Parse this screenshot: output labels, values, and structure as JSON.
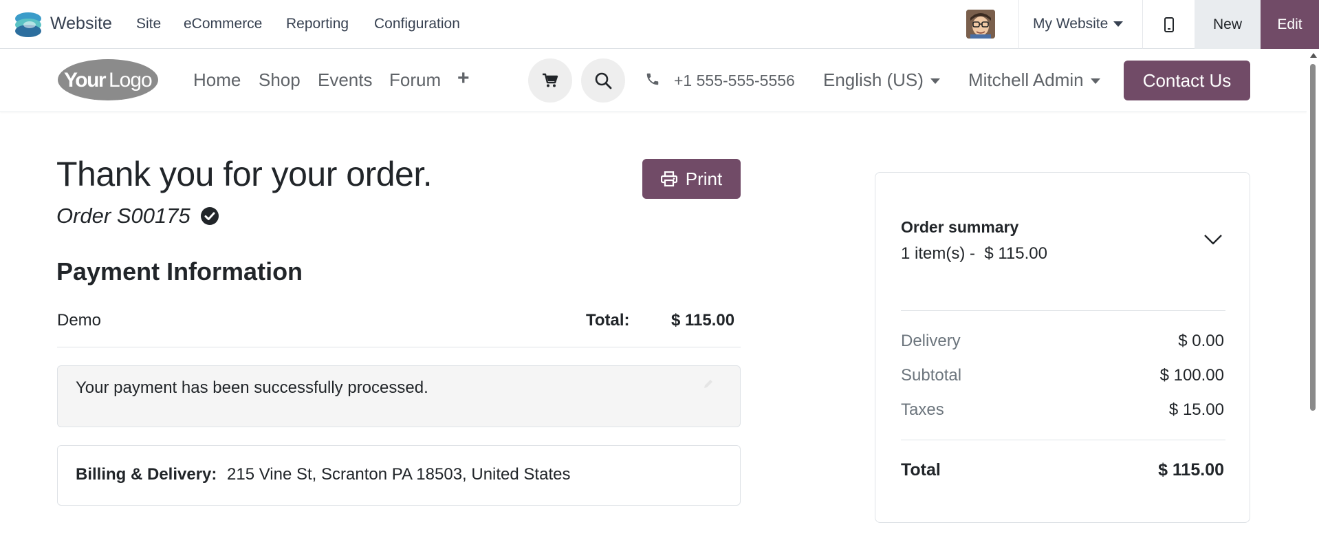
{
  "adminbar": {
    "app_name": "Website",
    "menus": [
      "Site",
      "eCommerce",
      "Reporting",
      "Configuration"
    ],
    "site_selector": "My Website",
    "new_label": "New",
    "edit_label": "Edit"
  },
  "header": {
    "logo_text_bold": "Your",
    "logo_text_light": "Logo",
    "nav": [
      "Home",
      "Shop",
      "Events",
      "Forum"
    ],
    "phone": "+1 555-555-5556",
    "language": "English (US)",
    "user": "Mitchell Admin",
    "contact_label": "Contact Us"
  },
  "main": {
    "title": "Thank you for your order.",
    "order_ref": "Order S00175",
    "print_label": "Print",
    "payment_title": "Payment Information",
    "payment_method": "Demo",
    "total_label": "Total:",
    "total_value": "$ 115.00",
    "payment_message": "Your payment has been successfully processed.",
    "address_label": "Billing & Delivery:",
    "address_value": "215 Vine St, Scranton PA 18503, United States"
  },
  "summary": {
    "title": "Order summary",
    "subtitle": "1 item(s) -  $ 115.00",
    "rows": [
      {
        "label": "Delivery",
        "value": "$ 0.00"
      },
      {
        "label": "Subtotal",
        "value": "$ 100.00"
      },
      {
        "label": "Taxes",
        "value": "$ 15.00"
      }
    ],
    "total_label": "Total",
    "total_value": "$ 115.00"
  },
  "colors": {
    "brand": "#714b67",
    "text": "#212529",
    "muted": "#6c757d"
  }
}
